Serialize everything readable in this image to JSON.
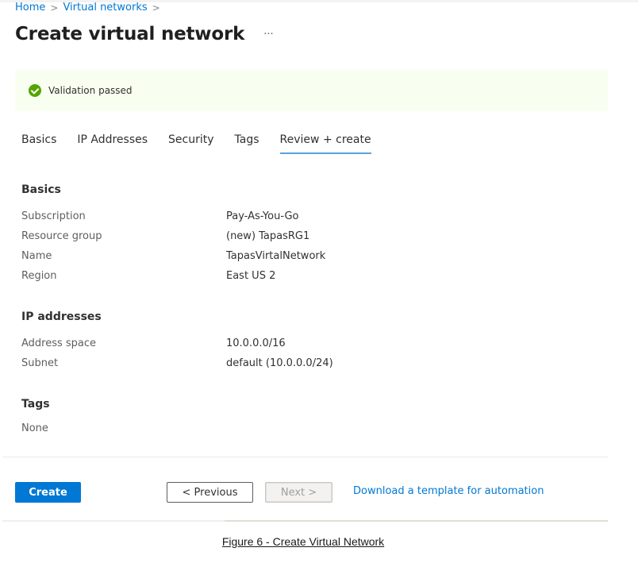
{
  "breadcrumb": {
    "items": [
      "Home",
      "Virtual networks"
    ],
    "separator": ">"
  },
  "header": {
    "title": "Create virtual network",
    "more_label": "···"
  },
  "banner": {
    "icon": "check-circle-icon",
    "text": "Validation passed",
    "status_color": "#57a300"
  },
  "tabs": [
    {
      "label": "Basics",
      "active": false
    },
    {
      "label": "IP Addresses",
      "active": false
    },
    {
      "label": "Security",
      "active": false
    },
    {
      "label": "Tags",
      "active": false
    },
    {
      "label": "Review + create",
      "active": true
    }
  ],
  "review": {
    "basics": {
      "title": "Basics",
      "rows": [
        {
          "label": "Subscription",
          "value": "Pay-As-You-Go"
        },
        {
          "label": "Resource group",
          "value": "(new) TapasRG1"
        },
        {
          "label": "Name",
          "value": "TapasVirtalNetwork"
        },
        {
          "label": "Region",
          "value": "East US 2"
        }
      ]
    },
    "ip_addresses": {
      "title": "IP addresses",
      "rows": [
        {
          "label": "Address space",
          "value": "10.0.0.0/16"
        },
        {
          "label": "Subnet",
          "value": "default (10.0.0.0/24)"
        }
      ]
    },
    "tags": {
      "title": "Tags",
      "value": "None"
    }
  },
  "footer": {
    "create_label": "Create",
    "previous_label": "< Previous",
    "next_label": "Next >",
    "download_link": "Download a template for automation",
    "accent_color": "#0078d4"
  },
  "caption": "Figure 6 - Create Virtual Network"
}
